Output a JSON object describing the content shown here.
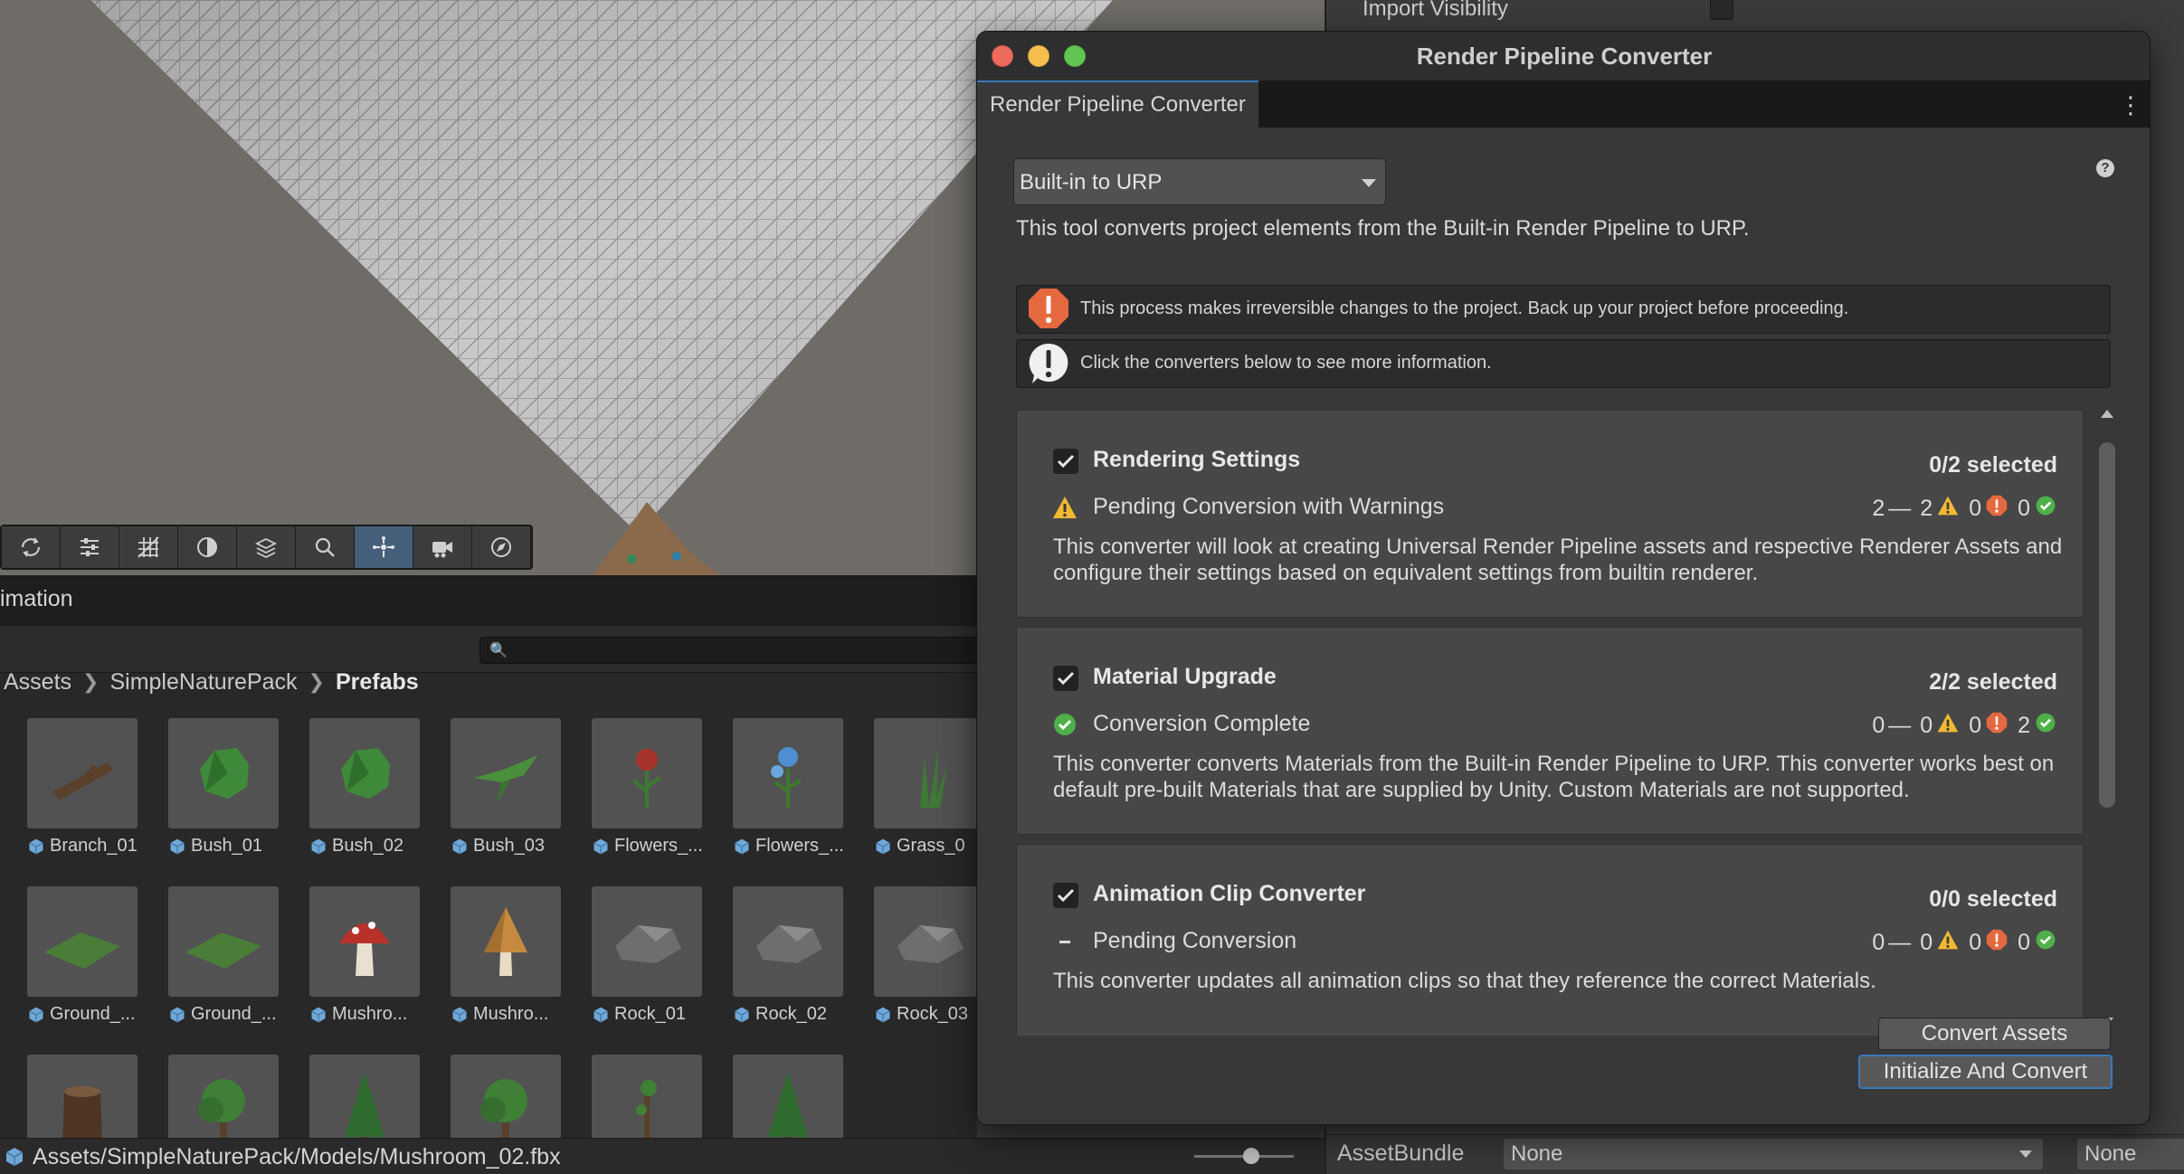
{
  "scene": {
    "toolbar": [
      {
        "name": "refresh-icon"
      },
      {
        "name": "sliders-icon"
      },
      {
        "name": "grid-icon"
      },
      {
        "name": "shading-icon"
      },
      {
        "name": "layers-icon"
      },
      {
        "name": "search-icon"
      },
      {
        "name": "gizmos-icon",
        "active": true
      },
      {
        "name": "camera-icon"
      },
      {
        "name": "compass-icon"
      }
    ]
  },
  "project": {
    "tab_label": "imation",
    "breadcrumb": [
      "Assets",
      "SimpleNaturePack",
      "Prefabs"
    ],
    "assets": [
      {
        "label": "Branch_01",
        "kind": "branch"
      },
      {
        "label": "Bush_01",
        "kind": "bush"
      },
      {
        "label": "Bush_02",
        "kind": "bush"
      },
      {
        "label": "Bush_03",
        "kind": "leaf"
      },
      {
        "label": "Flowers_...",
        "kind": "flower-red"
      },
      {
        "label": "Flowers_...",
        "kind": "flower-blue"
      },
      {
        "label": "Grass_0",
        "kind": "grass"
      },
      {
        "label": "Ground_...",
        "kind": "ground"
      },
      {
        "label": "Ground_...",
        "kind": "ground"
      },
      {
        "label": "Mushro...",
        "kind": "mushroom-red"
      },
      {
        "label": "Mushro...",
        "kind": "mushroom-brown"
      },
      {
        "label": "Rock_01",
        "kind": "rock"
      },
      {
        "label": "Rock_02",
        "kind": "rock"
      },
      {
        "label": "Rock_03",
        "kind": "rock"
      },
      {
        "label": "",
        "kind": "stump"
      },
      {
        "label": "",
        "kind": "tree"
      },
      {
        "label": "",
        "kind": "pine"
      },
      {
        "label": "",
        "kind": "tree"
      },
      {
        "label": "",
        "kind": "sapling"
      },
      {
        "label": "",
        "kind": "pine"
      }
    ],
    "status_path": "Assets/SimpleNaturePack/Models/Mushroom_02.fbx"
  },
  "inspector": {
    "import_visibility_label": "Import Visibility",
    "assetbundle_label": "AssetBundle",
    "assetbundle_value": "None",
    "assetbundle_variant": "None"
  },
  "dialog": {
    "window_title": "Render Pipeline Converter",
    "tab_label": "Render Pipeline Converter",
    "dropdown_value": "Built-in to URP",
    "description": "This tool converts project elements from the Built-in Render Pipeline to URP.",
    "warning_text": "This process makes irreversible changes to the project. Back up your project before proceeding.",
    "info_text": "Click the converters below to see more information.",
    "converters": [
      {
        "name": "Rendering Settings",
        "selected": "0/2 selected",
        "status": "Pending Conversion with Warnings",
        "status_icon": "warning-icon",
        "counts": {
          "pending": "2",
          "warnings": "2",
          "errors": "0",
          "success": "0"
        },
        "description": "This converter will look at creating Universal Render Pipeline assets and respective Renderer Assets and configure their settings based on equivalent settings from builtin renderer."
      },
      {
        "name": "Material Upgrade",
        "selected": "2/2 selected",
        "status": "Conversion Complete",
        "status_icon": "success-icon",
        "counts": {
          "pending": "0",
          "warnings": "0",
          "errors": "0",
          "success": "2"
        },
        "description": "This converter converts Materials from the Built-in Render Pipeline to URP. This converter works best on default pre-built Materials that are supplied by Unity. Custom Materials are not supported."
      },
      {
        "name": "Animation Clip Converter",
        "selected": "0/0 selected",
        "status": "Pending Conversion",
        "status_icon": "dash-icon",
        "counts": {
          "pending": "0",
          "warnings": "0",
          "errors": "0",
          "success": "0"
        },
        "description": "This converter updates all animation clips so that they reference the correct Materials."
      }
    ],
    "convert_assets_label": "Convert Assets",
    "init_convert_label": "Initialize And Convert",
    "colors": {
      "accent": "#3a79bb",
      "warning": "#f1b932",
      "error": "#e5683f",
      "success": "#4fb04a"
    }
  }
}
